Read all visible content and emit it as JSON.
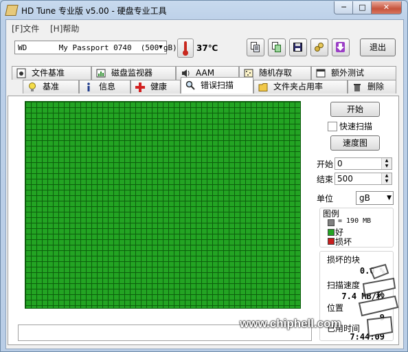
{
  "window": {
    "title": "HD Tune 专业版 v5.00 - 硬盘专业工具",
    "controls": {
      "minimize": "─",
      "maximize": "□",
      "close": "✕"
    }
  },
  "menu": [
    "[F]文件",
    "[H]帮助"
  ],
  "toolbar": {
    "drive": "WD       My Passport 0740  (500 gB)",
    "temperature": "37℃",
    "exit_label": "退出",
    "icons": [
      "copy-text-icon",
      "copy-screenshot-icon",
      "save-icon",
      "options-icon",
      "download-icon"
    ]
  },
  "tabs": {
    "row1": [
      {
        "label": "文件基准",
        "icon": "file-benchmark-icon"
      },
      {
        "label": "磁盘监视器",
        "icon": "disk-monitor-icon"
      },
      {
        "label": "AAM",
        "icon": "speaker-icon"
      },
      {
        "label": "随机存取",
        "icon": "random-access-icon"
      },
      {
        "label": "额外测试",
        "icon": "extra-tests-icon"
      }
    ],
    "row2": [
      {
        "label": "基准",
        "icon": "lightbulb-icon"
      },
      {
        "label": "信息",
        "icon": "info-icon"
      },
      {
        "label": "健康",
        "icon": "health-cross-icon"
      },
      {
        "label": "错误扫描",
        "icon": "magnifier-icon",
        "active": true
      },
      {
        "label": "文件夹占用率",
        "icon": "folder-icon"
      },
      {
        "label": "删除",
        "icon": "trash-icon"
      }
    ]
  },
  "side": {
    "start_button": "开始",
    "quick_scan": "快速扫描",
    "quick_scan_checked": false,
    "speed_map": "速度图",
    "start_label": "开始",
    "start_value": "0",
    "end_label": "结束",
    "end_value": "500",
    "unit_label": "单位",
    "unit_value": "gB",
    "legend_title": "图例",
    "legend_block": "= 190 MB",
    "legend_good": "好",
    "legend_bad": "损坏",
    "damaged_title": "损坏的块",
    "damaged_value": "0.0 %",
    "speed_label": "扫描速度",
    "speed_value": "7.4 MB/秒",
    "position_label": "位置",
    "position_value": "9",
    "elapsed_label": "已用时间",
    "elapsed_value": "7:44:09"
  },
  "scan": {
    "completed_fraction": 1.0,
    "status_text": ""
  },
  "colors": {
    "good": "#23a423",
    "bad": "#c81e1e",
    "block": "#808080"
  },
  "watermark": "www.chiphell.com"
}
